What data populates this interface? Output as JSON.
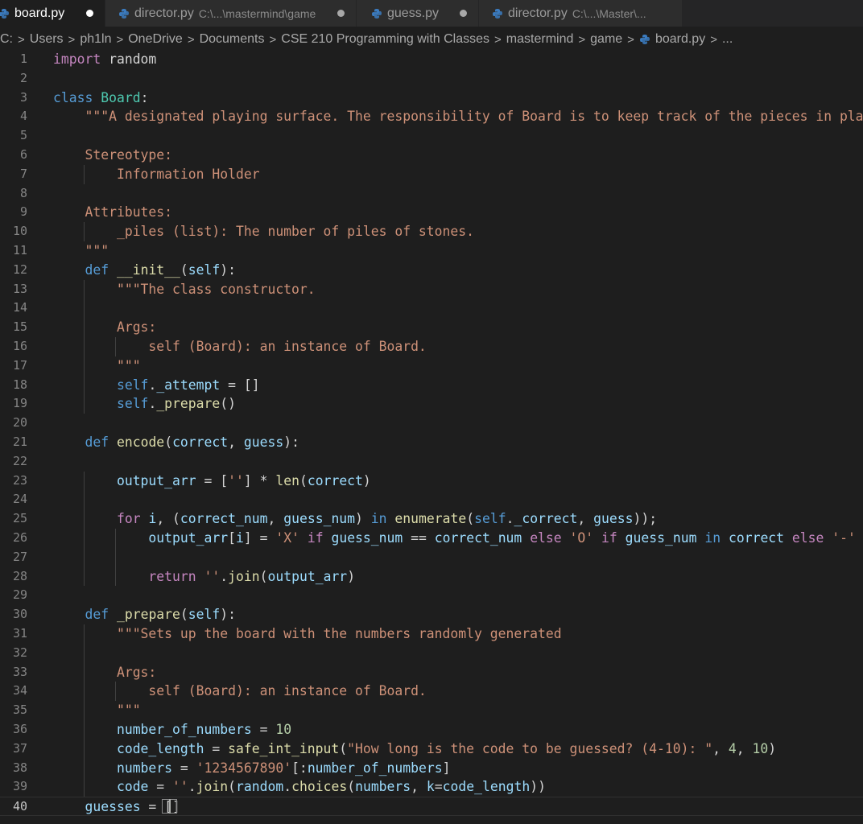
{
  "tabs": [
    {
      "name": "board.py",
      "path": "",
      "active": true
    },
    {
      "name": "director.py",
      "path": "C:\\...\\mastermind\\game",
      "active": false
    },
    {
      "name": "guess.py",
      "path": "",
      "active": false
    },
    {
      "name": "director.py",
      "path": "C:\\...\\Master\\...",
      "active": false
    }
  ],
  "breadcrumb": [
    "C:",
    "Users",
    "ph1ln",
    "OneDrive",
    "Documents",
    "CSE 210 Programming with Classes",
    "mastermind",
    "game",
    "board.py",
    "..."
  ],
  "colors": {
    "keyword": "#c586c0",
    "declaration": "#569cd6",
    "class": "#4ec9b0",
    "function": "#dcdcaa",
    "string": "#ce9178",
    "number": "#b5cea8",
    "variable": "#9cdcfe",
    "python_icon": "#3b7bbf"
  },
  "icons": {
    "file": "python-file-icon",
    "modified": "unsaved-dot-icon",
    "separator": "chevron-right-icon"
  },
  "current_line": 40,
  "lines": [
    [
      [
        "kw",
        "import"
      ],
      [
        "plain",
        " random"
      ]
    ],
    [],
    [
      [
        "kd",
        "class"
      ],
      [
        "plain",
        " "
      ],
      [
        "cls",
        "Board"
      ],
      [
        "plain",
        ":"
      ]
    ],
    [
      [
        "plain",
        "    "
      ],
      [
        "str",
        "\"\"\"A designated playing surface. The responsibility of Board is to keep track of the pieces in play."
      ]
    ],
    [],
    [
      [
        "plain",
        "    "
      ],
      [
        "str",
        "Stereotype:"
      ]
    ],
    [
      [
        "plain",
        "        "
      ],
      [
        "str",
        "Information Holder"
      ]
    ],
    [],
    [
      [
        "plain",
        "    "
      ],
      [
        "str",
        "Attributes:"
      ]
    ],
    [
      [
        "plain",
        "        "
      ],
      [
        "str",
        "_piles (list): The number of piles of stones."
      ]
    ],
    [
      [
        "plain",
        "    "
      ],
      [
        "str",
        "\"\"\""
      ]
    ],
    [
      [
        "plain",
        "    "
      ],
      [
        "kd",
        "def"
      ],
      [
        "plain",
        " "
      ],
      [
        "fn",
        "__init__"
      ],
      [
        "plain",
        "("
      ],
      [
        "var",
        "self"
      ],
      [
        "plain",
        "):"
      ]
    ],
    [
      [
        "plain",
        "        "
      ],
      [
        "str",
        "\"\"\"The class constructor."
      ]
    ],
    [],
    [
      [
        "plain",
        "        "
      ],
      [
        "str",
        "Args:"
      ]
    ],
    [
      [
        "plain",
        "            "
      ],
      [
        "str",
        "self (Board): an instance of Board."
      ]
    ],
    [
      [
        "plain",
        "        "
      ],
      [
        "str",
        "\"\"\""
      ]
    ],
    [
      [
        "plain",
        "        "
      ],
      [
        "self",
        "self"
      ],
      [
        "plain",
        "."
      ],
      [
        "var",
        "_attempt"
      ],
      [
        "plain",
        " = []"
      ]
    ],
    [
      [
        "plain",
        "        "
      ],
      [
        "self",
        "self"
      ],
      [
        "plain",
        "."
      ],
      [
        "fn",
        "_prepare"
      ],
      [
        "plain",
        "()"
      ]
    ],
    [],
    [
      [
        "plain",
        "    "
      ],
      [
        "kd",
        "def"
      ],
      [
        "plain",
        " "
      ],
      [
        "fn",
        "encode"
      ],
      [
        "plain",
        "("
      ],
      [
        "var",
        "correct"
      ],
      [
        "plain",
        ", "
      ],
      [
        "var",
        "guess"
      ],
      [
        "plain",
        "):"
      ]
    ],
    [],
    [
      [
        "plain",
        "        "
      ],
      [
        "var",
        "output_arr"
      ],
      [
        "plain",
        " = ["
      ],
      [
        "str",
        "''"
      ],
      [
        "plain",
        "] * "
      ],
      [
        "fn",
        "len"
      ],
      [
        "plain",
        "("
      ],
      [
        "var",
        "correct"
      ],
      [
        "plain",
        ")"
      ]
    ],
    [],
    [
      [
        "plain",
        "        "
      ],
      [
        "kw",
        "for"
      ],
      [
        "plain",
        " "
      ],
      [
        "var",
        "i"
      ],
      [
        "plain",
        ", ("
      ],
      [
        "var",
        "correct_num"
      ],
      [
        "plain",
        ", "
      ],
      [
        "var",
        "guess_num"
      ],
      [
        "plain",
        ") "
      ],
      [
        "kd",
        "in"
      ],
      [
        "plain",
        " "
      ],
      [
        "fn",
        "enumerate"
      ],
      [
        "plain",
        "("
      ],
      [
        "self",
        "self"
      ],
      [
        "plain",
        "."
      ],
      [
        "var",
        "_correct"
      ],
      [
        "plain",
        ", "
      ],
      [
        "var",
        "guess"
      ],
      [
        "plain",
        "));"
      ]
    ],
    [
      [
        "plain",
        "            "
      ],
      [
        "var",
        "output_arr"
      ],
      [
        "plain",
        "["
      ],
      [
        "var",
        "i"
      ],
      [
        "plain",
        "] = "
      ],
      [
        "str",
        "'X'"
      ],
      [
        "plain",
        " "
      ],
      [
        "kw",
        "if"
      ],
      [
        "plain",
        " "
      ],
      [
        "var",
        "guess_num"
      ],
      [
        "plain",
        " == "
      ],
      [
        "var",
        "correct_num"
      ],
      [
        "plain",
        " "
      ],
      [
        "kw",
        "else"
      ],
      [
        "plain",
        " "
      ],
      [
        "str",
        "'O'"
      ],
      [
        "plain",
        " "
      ],
      [
        "kw",
        "if"
      ],
      [
        "plain",
        " "
      ],
      [
        "var",
        "guess_num"
      ],
      [
        "plain",
        " "
      ],
      [
        "kd",
        "in"
      ],
      [
        "plain",
        " "
      ],
      [
        "var",
        "correct"
      ],
      [
        "plain",
        " "
      ],
      [
        "kw",
        "else"
      ],
      [
        "plain",
        " "
      ],
      [
        "str",
        "'-'"
      ]
    ],
    [],
    [
      [
        "plain",
        "            "
      ],
      [
        "kw",
        "return"
      ],
      [
        "plain",
        " "
      ],
      [
        "str",
        "''"
      ],
      [
        "plain",
        "."
      ],
      [
        "fn",
        "join"
      ],
      [
        "plain",
        "("
      ],
      [
        "var",
        "output_arr"
      ],
      [
        "plain",
        ")"
      ]
    ],
    [],
    [
      [
        "plain",
        "    "
      ],
      [
        "kd",
        "def"
      ],
      [
        "plain",
        " "
      ],
      [
        "fn",
        "_prepare"
      ],
      [
        "plain",
        "("
      ],
      [
        "var",
        "self"
      ],
      [
        "plain",
        "):"
      ]
    ],
    [
      [
        "plain",
        "        "
      ],
      [
        "str",
        "\"\"\"Sets up the board with the numbers randomly generated"
      ]
    ],
    [],
    [
      [
        "plain",
        "        "
      ],
      [
        "str",
        "Args:"
      ]
    ],
    [
      [
        "plain",
        "            "
      ],
      [
        "str",
        "self (Board): an instance of Board."
      ]
    ],
    [
      [
        "plain",
        "        "
      ],
      [
        "str",
        "\"\"\""
      ]
    ],
    [
      [
        "plain",
        "        "
      ],
      [
        "var",
        "number_of_numbers"
      ],
      [
        "plain",
        " = "
      ],
      [
        "num",
        "10"
      ]
    ],
    [
      [
        "plain",
        "        "
      ],
      [
        "var",
        "code_length"
      ],
      [
        "plain",
        " = "
      ],
      [
        "fn",
        "safe_int_input"
      ],
      [
        "plain",
        "("
      ],
      [
        "str",
        "\"How long is the code to be guessed? (4-10): \""
      ],
      [
        "plain",
        ", "
      ],
      [
        "num",
        "4"
      ],
      [
        "plain",
        ", "
      ],
      [
        "num",
        "10"
      ],
      [
        "plain",
        ")"
      ]
    ],
    [
      [
        "plain",
        "        "
      ],
      [
        "var",
        "numbers"
      ],
      [
        "plain",
        " = "
      ],
      [
        "str",
        "'1234567890'"
      ],
      [
        "plain",
        "[:"
      ],
      [
        "var",
        "number_of_numbers"
      ],
      [
        "plain",
        "]"
      ]
    ],
    [
      [
        "plain",
        "        "
      ],
      [
        "var",
        "code"
      ],
      [
        "plain",
        " = "
      ],
      [
        "str",
        "''"
      ],
      [
        "plain",
        "."
      ],
      [
        "fn",
        "join"
      ],
      [
        "plain",
        "("
      ],
      [
        "var",
        "random"
      ],
      [
        "plain",
        "."
      ],
      [
        "fn",
        "choices"
      ],
      [
        "plain",
        "("
      ],
      [
        "var",
        "numbers"
      ],
      [
        "plain",
        ", "
      ],
      [
        "var",
        "k"
      ],
      [
        "plain",
        "="
      ],
      [
        "var",
        "code_length"
      ],
      [
        "plain",
        "))"
      ]
    ],
    [
      [
        "plain",
        "    "
      ],
      [
        "var",
        "guesses"
      ],
      [
        "plain",
        " = []"
      ]
    ]
  ]
}
